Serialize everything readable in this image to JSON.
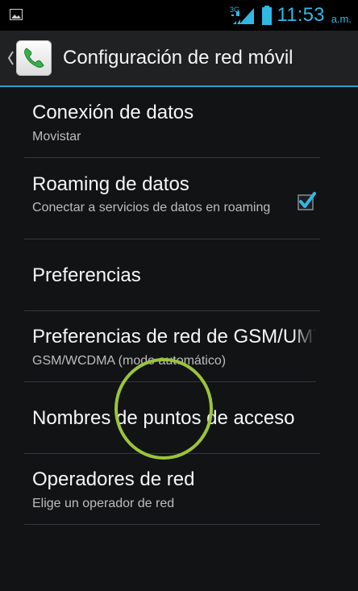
{
  "status_bar": {
    "network_type": "3G",
    "time": "11:53",
    "ampm": "a.m."
  },
  "action_bar": {
    "title": "Configuración de red móvil",
    "back_icon": "chevron-left-icon",
    "app_icon": "phone-icon"
  },
  "items": [
    {
      "title": "Conexión de datos",
      "summary": "Movistar"
    },
    {
      "title": "Roaming de datos",
      "summary": "Conectar a servicios de datos en roaming",
      "checked": true
    },
    {
      "title": "Preferencias",
      "summary": ""
    },
    {
      "title": "Preferencias de red de GSM/UMTS",
      "summary": "GSM/WCDMA (modo automático)"
    },
    {
      "title": "Nombres de puntos de acceso",
      "summary": ""
    },
    {
      "title": "Operadores de red",
      "summary": "Elige un operador de red"
    }
  ],
  "colors": {
    "accent": "#2fb8e6",
    "highlight_circle": "#9bc43b",
    "background": "#121315"
  }
}
